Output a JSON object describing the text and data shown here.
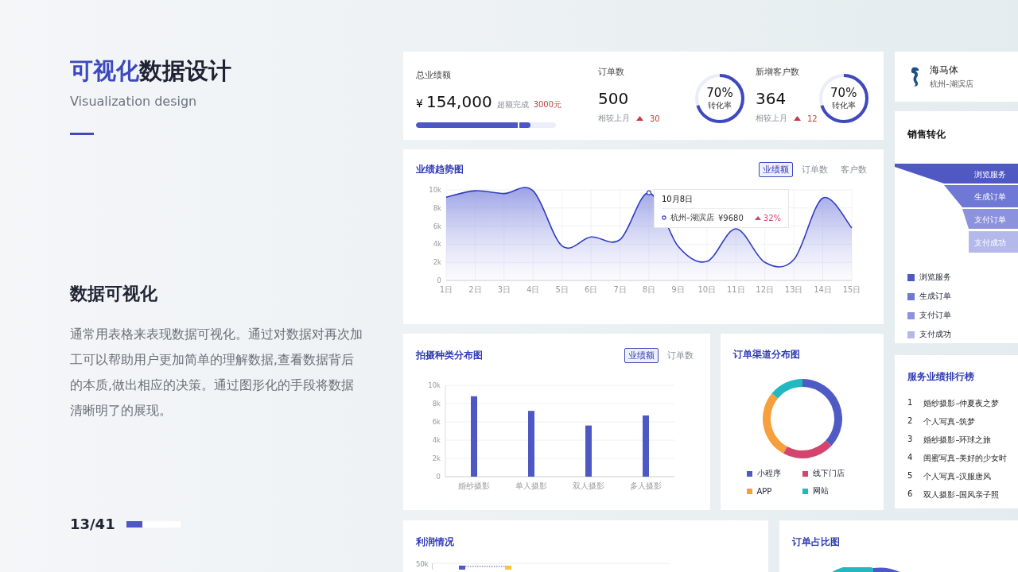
{
  "slide": {
    "title": "**可视化**数据设计",
    "subtitle": "Visualization design",
    "heading": "数据可视化",
    "paragraph": "通常用表格来表现数据可视化。通过对数据对再次加工可以帮助用户更加简单的理解数据,查看数据背后的本质,做出相应的决策。通过图形化的手段将数据清晰明了的展现。",
    "page": "13/41",
    "progress": {
      "level": 0.3
    }
  },
  "kpis": {
    "total": {
      "label": "总业绩额",
      "currency": "¥",
      "value": "154,000",
      "note": "超额完成",
      "extra": "3000元",
      "level": 0.82
    },
    "metrics": [
      {
        "label": "订单数",
        "value": "500",
        "compare": "相较上月",
        "change": "30",
        "level": 0.7,
        "percent": "70%",
        "ring_label": "转化率"
      },
      {
        "label": "新增客户数",
        "value": "364",
        "compare": "相较上月",
        "change": "12",
        "level": 0.7,
        "percent": "70%",
        "ring_label": "转化率"
      }
    ]
  },
  "store": {
    "name": "海马体",
    "branch": "杭州–湖滨店"
  },
  "trend": {
    "title": "业绩趋势图",
    "tabs": [
      {
        "label": "业绩额",
        "selected": true
      },
      {
        "label": "订单数",
        "selected": false
      },
      {
        "label": "客户数",
        "selected": false
      }
    ],
    "chart_data": {
      "type": "area",
      "categories": [
        "1日",
        "2日",
        "3日",
        "4日",
        "5日",
        "6日",
        "7日",
        "8日",
        "9日",
        "10日",
        "11日",
        "12日",
        "13日",
        "14日",
        "15日"
      ],
      "grid": true,
      "series": [
        {
          "color": "#2f3cc0",
          "values": [
            9200,
            9900,
            9600,
            9900,
            3800,
            4800,
            4500,
            9680,
            3800,
            2100,
            5700,
            2000,
            2300,
            9100,
            5800
          ]
        }
      ],
      "ylim": [
        0,
        10000
      ],
      "yticks": [
        {
          "value": 0,
          "label": "0"
        },
        {
          "value": 2000,
          "label": "2k"
        },
        {
          "value": 4000,
          "label": "4k"
        },
        {
          "value": 6000,
          "label": "6k"
        },
        {
          "value": 8000,
          "label": "8k"
        },
        {
          "value": 10000,
          "label": "10k"
        }
      ]
    },
    "tooltip": {
      "date": "10月8日",
      "store": "杭州–湖滨店",
      "value": "¥9680",
      "change": "32%"
    }
  },
  "funnel": {
    "title": "销售转化",
    "stages": [
      {
        "label": "浏览服务",
        "color": "#5058c2"
      },
      {
        "label": "生成订单",
        "color": "#6f78d4"
      },
      {
        "label": "支付订单",
        "color": "#8c93dc"
      },
      {
        "label": "支付成功",
        "color": "#b4b9ec"
      }
    ],
    "legend": [
      {
        "label": "浏览服务",
        "color": "#5058c2"
      },
      {
        "label": "生成订单",
        "color": "#6f78d4"
      },
      {
        "label": "支付订单",
        "color": "#8c93dc"
      },
      {
        "label": "支付成功",
        "color": "#b4b9ec"
      }
    ]
  },
  "category": {
    "title": "拍摄种类分布图",
    "tabs": [
      {
        "label": "业绩额",
        "selected": true
      },
      {
        "label": "订单数",
        "selected": false
      }
    ],
    "chart_data": {
      "type": "bar",
      "categories": [
        "婚纱摄影",
        "单人摄影",
        "双人摄影",
        "多人摄影"
      ],
      "grid": true,
      "values": [
        8800,
        7200,
        5600,
        6700
      ],
      "ylim": [
        0,
        10000
      ],
      "yticks": [
        {
          "value": 0,
          "label": "0"
        },
        {
          "value": 2000,
          "label": "2k"
        },
        {
          "value": 4000,
          "label": "4k"
        },
        {
          "value": 6000,
          "label": "6k"
        },
        {
          "value": 8000,
          "label": "8k"
        },
        {
          "value": 10000,
          "label": "10k"
        }
      ]
    }
  },
  "channel": {
    "title": "订单渠道分布图",
    "chart_data": {
      "type": "donut",
      "categories": [
        "小程序",
        "线下门店",
        "APP",
        "网站"
      ],
      "values": [
        37,
        21,
        28,
        14
      ]
    },
    "legend": [
      {
        "color": "#4f5bc4"
      },
      {
        "color": "#d4456e"
      },
      {
        "color": "#f5a03c"
      },
      {
        "color": "#22b8bf"
      }
    ]
  },
  "ranking": {
    "title": "服务业绩排行榜",
    "items": [
      {
        "rank": "1",
        "name": "婚纱摄影–仲夏夜之梦"
      },
      {
        "rank": "2",
        "name": "个人写真–筑梦"
      },
      {
        "rank": "3",
        "name": "婚纱摄影–环球之旅"
      },
      {
        "rank": "4",
        "name": "闺蜜写真–美好的少女时"
      },
      {
        "rank": "5",
        "name": "个人写真–汉服唐风"
      },
      {
        "rank": "6",
        "name": "双人摄影–国风亲子照"
      }
    ]
  },
  "profit": {
    "title": "利润情况",
    "axis_label": "50k"
  },
  "order_share": {
    "title": "订单占比图"
  }
}
